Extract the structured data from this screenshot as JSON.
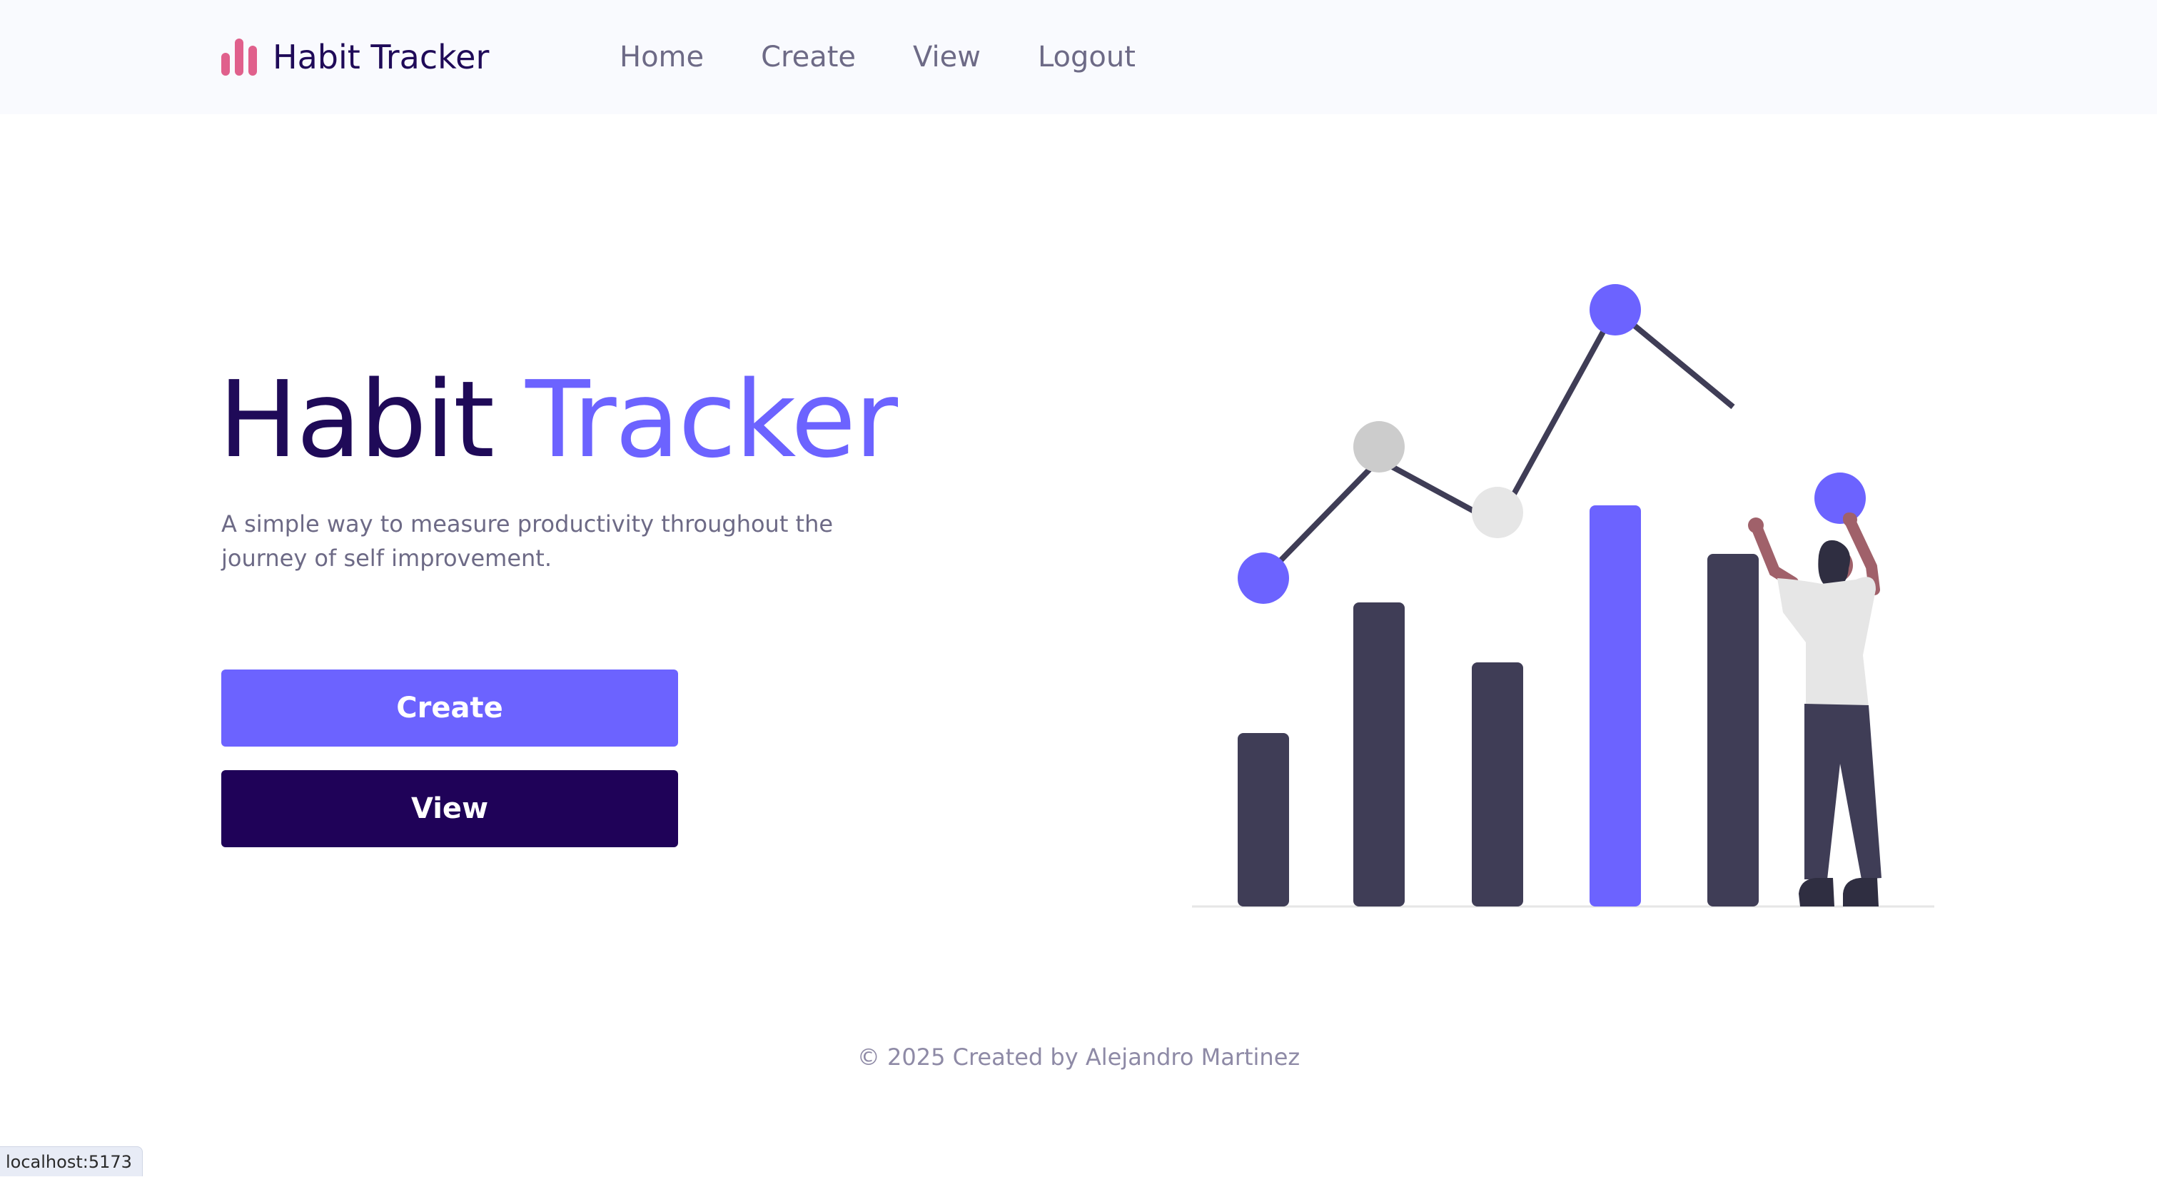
{
  "navbar": {
    "brand": "Habit Tracker",
    "brand_icon": "bar-chart-icon",
    "links": [
      {
        "label": "Home"
      },
      {
        "label": "Create"
      },
      {
        "label": "View"
      },
      {
        "label": "Logout"
      }
    ]
  },
  "hero": {
    "title_part1": "Habit",
    "title_part2": "Tracker",
    "subtitle": "A simple way to measure productivity throughout the journey of self improvement.",
    "create_button": "Create",
    "view_button": "View"
  },
  "illustration": {
    "name": "growth-chart-illustration",
    "bar_levels": [
      0.32,
      0.56,
      0.45,
      0.74,
      0.65
    ],
    "bar_colors": [
      "#3f3d56",
      "#3f3d56",
      "#3f3d56",
      "#6c63ff",
      "#3f3d56"
    ],
    "accent_color": "#6c63ff",
    "dark_color": "#3f3d56"
  },
  "footer": {
    "text": "© 2025 Created by Alejandro Martinez"
  },
  "status_bar": {
    "url": "localhost:5173"
  },
  "colors": {
    "primary": "#6c63ff",
    "navy": "#1f0258",
    "brand_icon": "#e0608c",
    "nav_background": "#f9fafe"
  }
}
